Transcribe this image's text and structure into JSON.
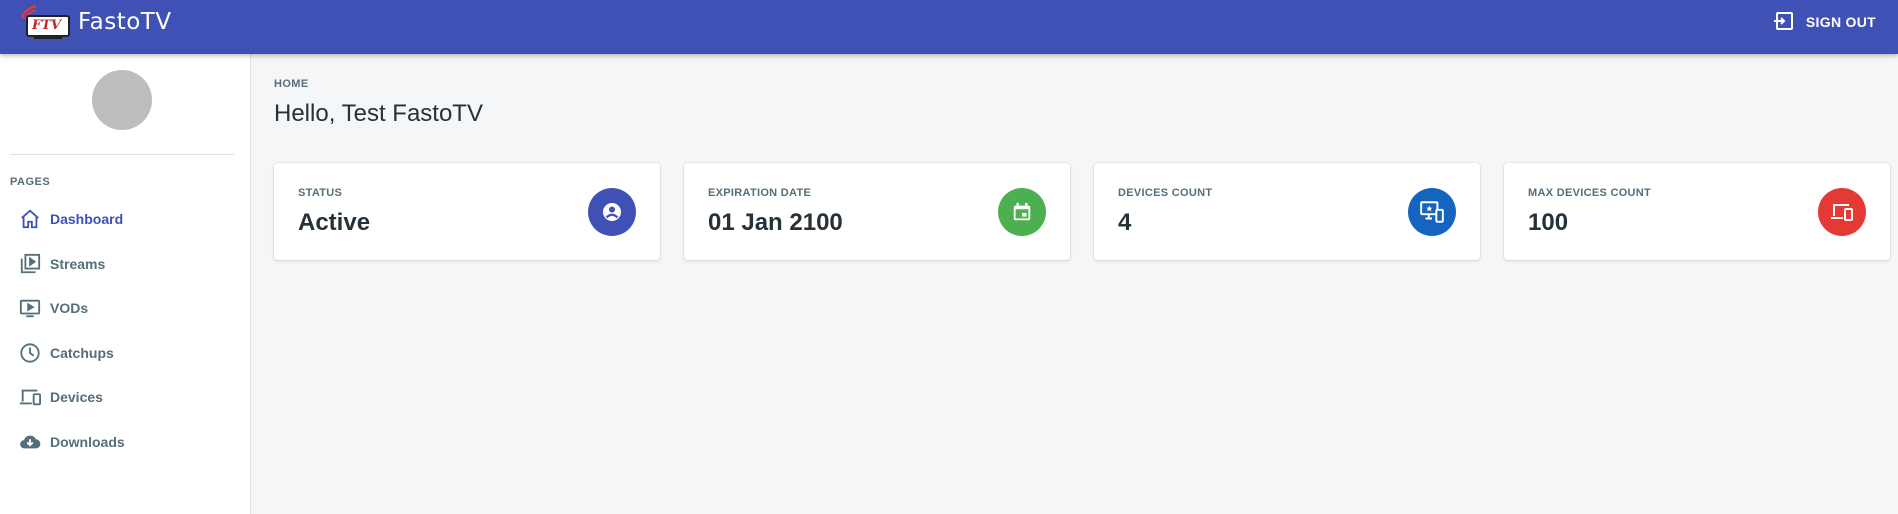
{
  "app": {
    "name": "FastoTV",
    "logo_text": "FTV"
  },
  "topbar": {
    "signout_label": "SIGN OUT"
  },
  "sidebar": {
    "section_label": "PAGES",
    "items": [
      {
        "label": "Dashboard",
        "icon": "home-icon",
        "active": true
      },
      {
        "label": "Streams",
        "icon": "video-library-icon",
        "active": false
      },
      {
        "label": "VODs",
        "icon": "tv-play-icon",
        "active": false
      },
      {
        "label": "Catchups",
        "icon": "clock-icon",
        "active": false
      },
      {
        "label": "Devices",
        "icon": "devices-icon",
        "active": false
      },
      {
        "label": "Downloads",
        "icon": "cloud-download-icon",
        "active": false
      }
    ]
  },
  "main": {
    "breadcrumb": "HOME",
    "greeting": "Hello, Test FastoTV",
    "cards": [
      {
        "label": "STATUS",
        "value": "Active",
        "icon": "account-circle-icon",
        "color": "#3f51b5"
      },
      {
        "label": "EXPIRATION DATE",
        "value": "01 Jan 2100",
        "icon": "calendar-icon",
        "color": "#4caf50"
      },
      {
        "label": "DEVICES COUNT",
        "value": "4",
        "icon": "connected-tv-icon",
        "color": "#1565c0"
      },
      {
        "label": "MAX DEVICES COUNT",
        "value": "100",
        "icon": "devices-icon",
        "color": "#e53935"
      }
    ]
  },
  "colors": {
    "primary": "#3f51b5",
    "background": "#f4f6f8",
    "text_secondary": "#546e7a"
  }
}
